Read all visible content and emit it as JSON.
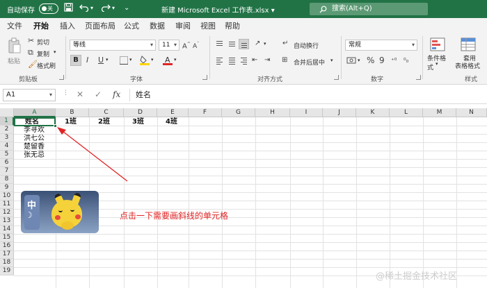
{
  "titlebar": {
    "autosave_label": "自动保存",
    "autosave_state": "关",
    "save_icon": "save-icon",
    "undo_icon": "undo-icon",
    "redo_icon": "redo-icon",
    "document_title": "新建 Microsoft Excel 工作表.xlsx",
    "title_caret": "▾",
    "search_text": "搜索(Alt+Q)",
    "brand_color": "#217346"
  },
  "menu": {
    "tabs": [
      "文件",
      "开始",
      "插入",
      "页面布局",
      "公式",
      "数据",
      "审阅",
      "视图",
      "帮助"
    ],
    "active": "开始"
  },
  "ribbon": {
    "clipboard": {
      "paste": "粘贴",
      "cut": "剪切",
      "copy": "复制",
      "format_painter": "格式刷",
      "group": "剪贴板"
    },
    "font": {
      "font_name": "等线",
      "font_size": "11",
      "bold": "B",
      "italic": "I",
      "underline": "U",
      "group": "字体"
    },
    "alignment": {
      "wrap_text": "自动换行",
      "merge_center": "合并后居中",
      "group": "对齐方式"
    },
    "number": {
      "format": "常规",
      "percent": "%",
      "comma": "9",
      "group": "数字"
    },
    "styles": {
      "conditional_format": "条件格式",
      "format_as_table": "套用",
      "format_as_table_2": "表格格式",
      "group": "样式"
    }
  },
  "formula_bar": {
    "name_box": "A1",
    "cancel": "✕",
    "enter": "✓",
    "fx": "fx",
    "value": "姓名"
  },
  "sheet": {
    "columns": [
      "A",
      "B",
      "C",
      "D",
      "E",
      "F",
      "G",
      "H",
      "I",
      "J",
      "K",
      "L",
      "M",
      "N"
    ],
    "rows": [
      "1",
      "2",
      "3",
      "4",
      "5",
      "6",
      "7",
      "8",
      "9",
      "10",
      "11",
      "12",
      "13",
      "14",
      "15",
      "16",
      "17",
      "18",
      "19"
    ],
    "selected_cell": "A1",
    "header_row": [
      "姓名",
      "1班",
      "2班",
      "3班",
      "4班"
    ],
    "names": [
      "李寻欢",
      "洪七公",
      "楚留香",
      "张无忌"
    ]
  },
  "picture": {
    "badge_char": "中"
  },
  "annotation": {
    "text": "点击一下需要画斜线的单元格",
    "color": "#e02424"
  },
  "watermark": "@稀土掘金技术社区"
}
